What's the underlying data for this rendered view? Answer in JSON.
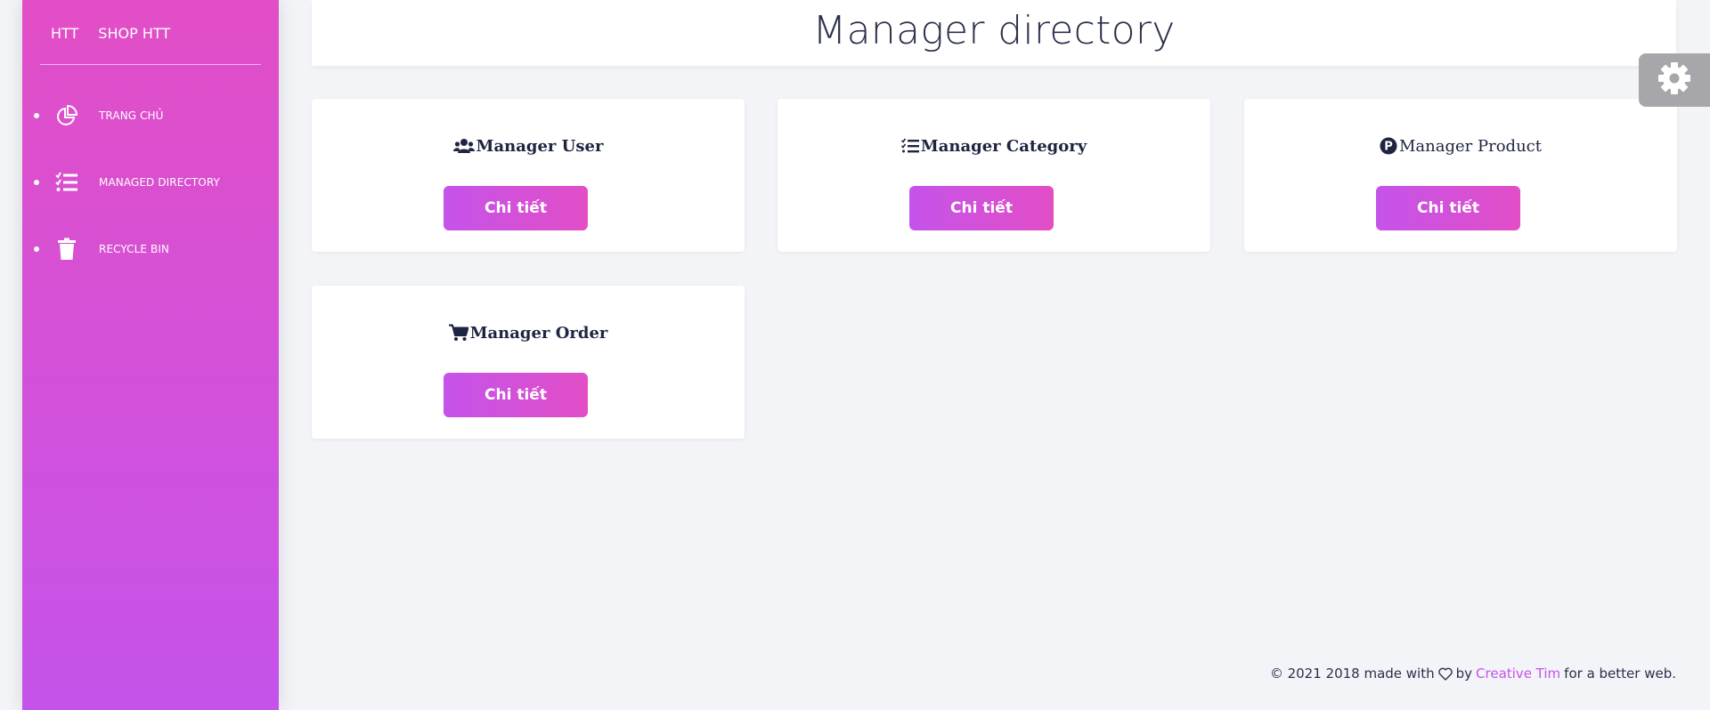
{
  "brand": {
    "short": "HTT",
    "name": "SHOP HTT"
  },
  "sidebar": {
    "items": [
      {
        "label": "TRANG CHỦ",
        "icon": "pie-chart-icon"
      },
      {
        "label": "MANAGED DIRECTORY",
        "icon": "tasks-list-icon"
      },
      {
        "label": "RECYCLE BIN",
        "icon": "trash-icon"
      }
    ]
  },
  "header": {
    "title": "Manager directory"
  },
  "cards": [
    {
      "title": "Manager User",
      "icon": "users-icon",
      "button": "Chi tiết"
    },
    {
      "title": "Manager Category",
      "icon": "tasks-list-icon",
      "button": "Chi tiết"
    },
    {
      "title": "Manager Product",
      "icon": "product-p-icon",
      "button": "Chi tiết"
    },
    {
      "title": "Manager Order",
      "icon": "shopping-cart-icon",
      "button": "Chi tiết"
    }
  ],
  "footer": {
    "prefix": "© 2021 2018 made with",
    "by": "by",
    "link": "Creative Tim",
    "suffix": "for a better web."
  },
  "colors": {
    "sidebar_top": "#e24ec6",
    "sidebar_bottom": "#c553ea",
    "accent": "#c553ea",
    "background": "#f3f4f8"
  }
}
